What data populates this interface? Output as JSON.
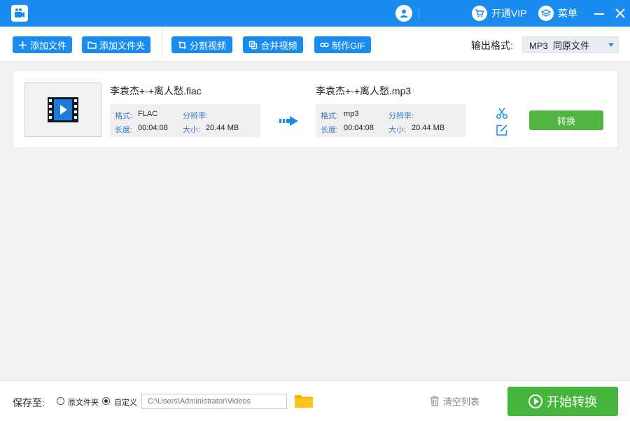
{
  "titlebar": {
    "vip_label": "开通VIP",
    "menu_label": "菜单",
    "colors": {
      "bar": "#1a8cf0"
    }
  },
  "toolbar": {
    "buttons": [
      {
        "label": "添加文件",
        "icon": "plus-icon"
      },
      {
        "label": "添加文件夹",
        "icon": "folder-outline-icon"
      },
      {
        "label": "分割视频",
        "icon": "crop-icon"
      },
      {
        "label": "合并视频",
        "icon": "merge-icon"
      },
      {
        "label": "制作GIF",
        "icon": "link-icon"
      }
    ],
    "output_format_label": "输出格式:",
    "output_format_value": "MP3  同原文件"
  },
  "file": {
    "source": {
      "name": "李袁杰+-+离人愁.flac",
      "format_label": "格式:",
      "format_value": "FLAC",
      "resolution_label": "分辨率:",
      "resolution_value": "",
      "duration_label": "长度:",
      "duration_value": "00:04:08",
      "size_label": "大小:",
      "size_value": "20.44 MB"
    },
    "target": {
      "name": "李袁杰+-+离人愁.mp3",
      "format_label": "格式:",
      "format_value": "mp3",
      "resolution_label": "分辨率:",
      "resolution_value": "",
      "duration_label": "长度:",
      "duration_value": "00:04:08",
      "size_label": "大小:",
      "size_value": "20.44 MB"
    },
    "convert_label": "转换"
  },
  "bottom": {
    "save_to_label": "保存至:",
    "option_original": "原文件夹",
    "option_custom": "自定义",
    "path_value": "C:\\Users\\Administrator\\Videos",
    "clear_label": "清空列表",
    "start_label": "开始转换"
  },
  "colors": {
    "accent": "#1a8cf0",
    "convert_green": "#52b541",
    "start_green": "#45b53b",
    "info_label_blue": "#3a78c8"
  }
}
